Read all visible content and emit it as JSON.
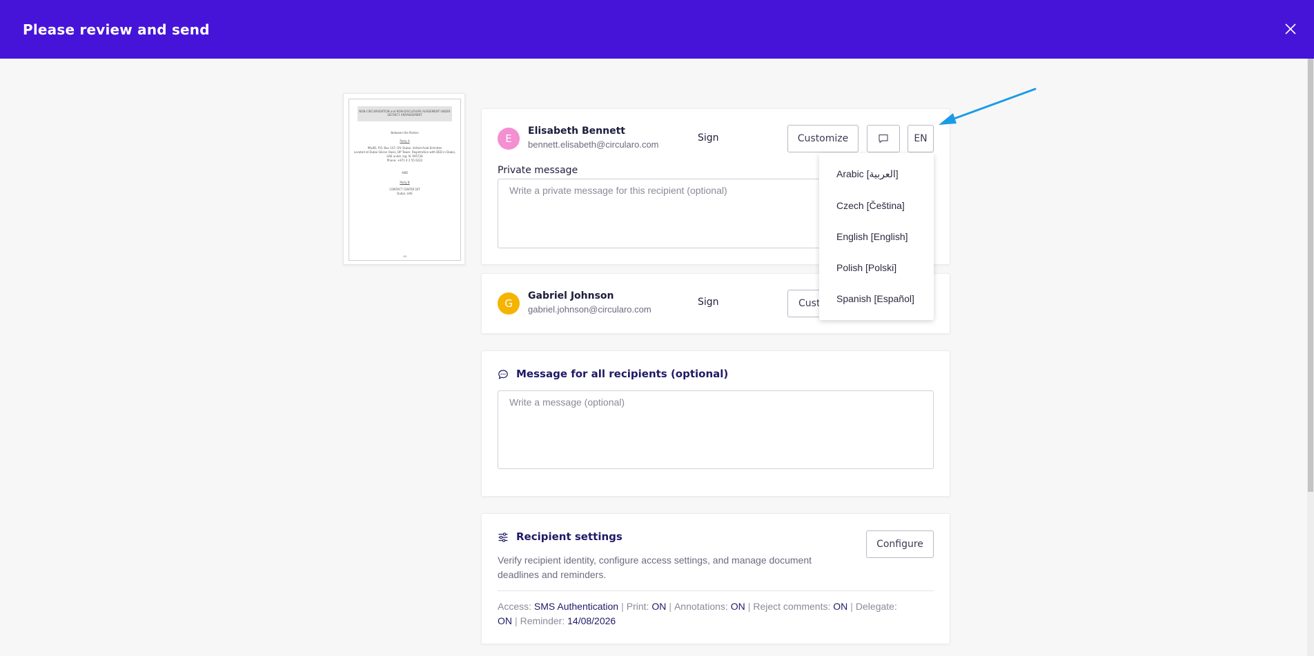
{
  "header": {
    "title": "Please review and send"
  },
  "document_preview": {
    "heading": "NON-CIRCUMVENTION and NON-DISCLOSURE AGREEMENT UNDER SECRECY ARRANGEMENT",
    "lines": [
      "Between the Parties",
      "Party A",
      "PALKO, P.O. Box 147, Ofc Dubai, United Arab Emirates",
      "Located at Dubai Silicon Oasis, DP Tower, Registration with DED in Dubai,",
      "UAE under reg. N. 695726",
      "Phone: +971 4 2 55 0222",
      "AND",
      "Party B",
      "CONTACT CENTER DIT",
      "Dubai, UAE"
    ],
    "page_number": "1/5"
  },
  "recipients": [
    {
      "initial": "E",
      "avatar_color": "#f48fd1",
      "name": "Elisabeth Bennett",
      "email": "bennett.elisabeth@circularo.com",
      "role": "Sign",
      "customize_label": "Customize",
      "language_label": "EN",
      "private_message_label": "Private message",
      "private_message_placeholder": "Write a private message for this recipient (optional)"
    },
    {
      "initial": "G",
      "avatar_color": "#f5b400",
      "name": "Gabriel Johnson",
      "email": "gabriel.johnson@circularo.com",
      "role": "Sign",
      "customize_label": "Cust"
    }
  ],
  "language_dropdown": {
    "options": [
      "Arabic [العربية]",
      "Czech [Čeština]",
      "English [English]",
      "Polish [Polski]",
      "Spanish [Español]"
    ]
  },
  "message_all": {
    "title": "Message for all recipients (optional)",
    "placeholder": "Write a message (optional)"
  },
  "recipient_settings": {
    "title": "Recipient settings",
    "description": "Verify recipient identity, configure access settings, and manage document deadlines and reminders.",
    "configure_label": "Configure",
    "access_label": "Access:",
    "access_value": "SMS Authentication",
    "print_label": "Print:",
    "print_value": "ON",
    "annotations_label": "Annotations:",
    "annotations_value": "ON",
    "reject_label": "Reject comments:",
    "reject_value": "ON",
    "delegate_label": "Delegate:",
    "delegate_value": "ON",
    "reminder_label": "Reminder:",
    "reminder_value": "14/08/2026"
  },
  "colors": {
    "header_bg": "#4614d8",
    "accent_text": "#1f1a66",
    "arrow": "#1a9be6"
  }
}
